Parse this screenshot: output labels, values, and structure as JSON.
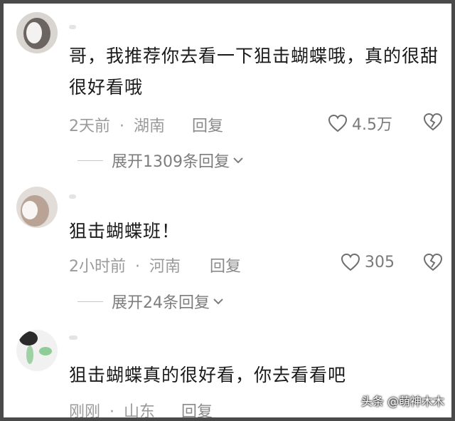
{
  "comments": [
    {
      "text": "哥，我推荐你去看一下狙击蝴蝶哦，真的很甜很好看哦",
      "time": "2天前",
      "location": "湖南",
      "reply_label": "回复",
      "likes": "4.5万",
      "expand_label": "展开1309条回复"
    },
    {
      "text": "狙击蝴蝶班！",
      "time": "2小时前",
      "location": "河南",
      "reply_label": "回复",
      "likes": "305",
      "expand_label": "展开24条回复"
    },
    {
      "text": "狙击蝴蝶真的很好看，你去看看吧",
      "time": "刚刚",
      "location": "山东",
      "reply_label": "回复"
    }
  ],
  "meta_separator": "·",
  "watermark": "头条 @萌神木木",
  "icons": {
    "like": "heart-outline-icon",
    "dislike": "broken-heart-icon",
    "expand": "chevron-down-icon"
  },
  "colors": {
    "text": "#1a1a1a",
    "meta": "#9a9a9a",
    "frame": "#4a4a4a"
  }
}
